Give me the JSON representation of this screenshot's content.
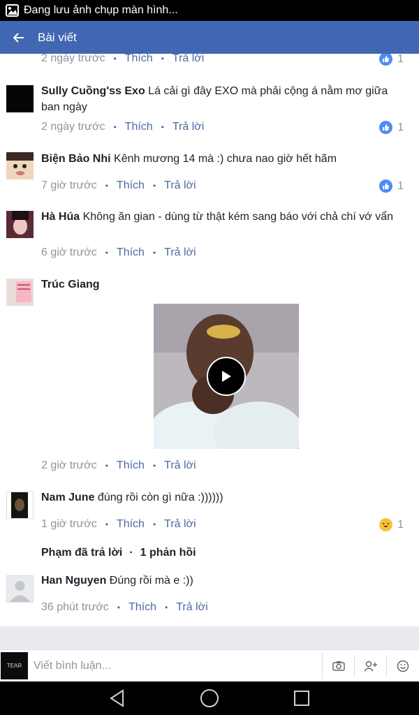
{
  "status_bar": {
    "text": "Đang lưu ảnh chụp màn hình..."
  },
  "header": {
    "title": "Bài viết"
  },
  "actions": {
    "like": "Thích",
    "reply": "Trả lời"
  },
  "top_meta": {
    "time": "2 ngày trước",
    "reaction_count": "1",
    "reaction": "like"
  },
  "comments": [
    {
      "author": "Sully Cuồng'ss Exo",
      "text": "Lá cải gì đây EXO mà phải cộng á nằm mơ giữa ban ngày",
      "time": "2 ngày trước",
      "reaction_count": "1",
      "reaction": "like"
    },
    {
      "author": "Biện Bảo Nhi",
      "text": "Kênh mương 14 mà :) chưa nao giờ hết hãm",
      "time": "7 giờ trước",
      "reaction_count": "1",
      "reaction": "like"
    },
    {
      "author": "Hà Húa",
      "text": "Không ăn gian - dùng từ thật kém sang báo với chả chí vớ vẩn",
      "time": "6 giờ trước",
      "reaction_count": "",
      "reaction": ""
    },
    {
      "author": "Trúc Giang",
      "text": "",
      "time": "2 giờ trước",
      "attachment": "video",
      "reaction_count": "",
      "reaction": ""
    },
    {
      "author": "Nam June",
      "text": "đúng rồi còn gì nữa :))))))",
      "time": "1 giờ trước",
      "reaction_count": "1",
      "reaction": "haha"
    }
  ],
  "replies_summary": {
    "who": "Phạm đã trả lời",
    "count": "1 phản hồi"
  },
  "reply": {
    "author": "Han Nguyen",
    "text": "Đúng rồi mà e :))",
    "time": "36 phút trước"
  },
  "composer": {
    "placeholder": "Viết bình luận...",
    "my_avatar_text": "TEAR"
  },
  "colors": {
    "brand": "#4267b2",
    "link": "#4b6aa3",
    "like": "#4f8cf4",
    "haha": "#f7c33d"
  }
}
